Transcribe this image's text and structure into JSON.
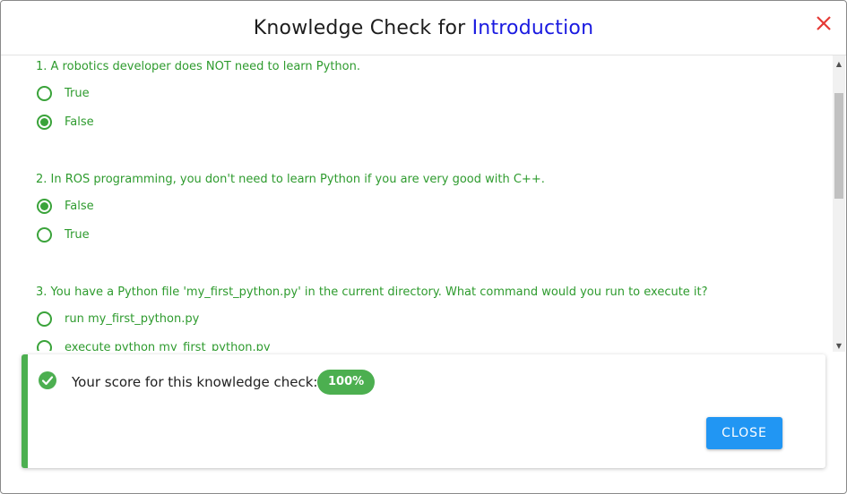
{
  "header": {
    "title_prefix": "Knowledge Check for ",
    "title_accent": "Introduction"
  },
  "questions": [
    {
      "text": "1. A robotics developer does NOT need to learn Python.",
      "options": [
        {
          "label": "True",
          "selected": false
        },
        {
          "label": "False",
          "selected": true
        }
      ]
    },
    {
      "text": "2. In ROS programming, you don't need to learn Python if you are very good with C++.",
      "options": [
        {
          "label": "False",
          "selected": true
        },
        {
          "label": "True",
          "selected": false
        }
      ]
    },
    {
      "text": "3. You have a Python file 'my_first_python.py' in the current directory. What command would you run to execute it?",
      "options": [
        {
          "label": "run my_first_python.py",
          "selected": false
        },
        {
          "label": "execute python my_first_python.py",
          "selected": false
        }
      ]
    }
  ],
  "score": {
    "label": "Your score for this knowledge check:",
    "value": "100%",
    "close_label": "CLOSE"
  },
  "colors": {
    "accent": "#1a1ae0",
    "success": "#4caf50",
    "option_text": "#2e9b2e",
    "button": "#2196f3",
    "close_icon": "#e53935"
  },
  "icons": {
    "close": "close-icon",
    "check": "check-circle-icon"
  }
}
